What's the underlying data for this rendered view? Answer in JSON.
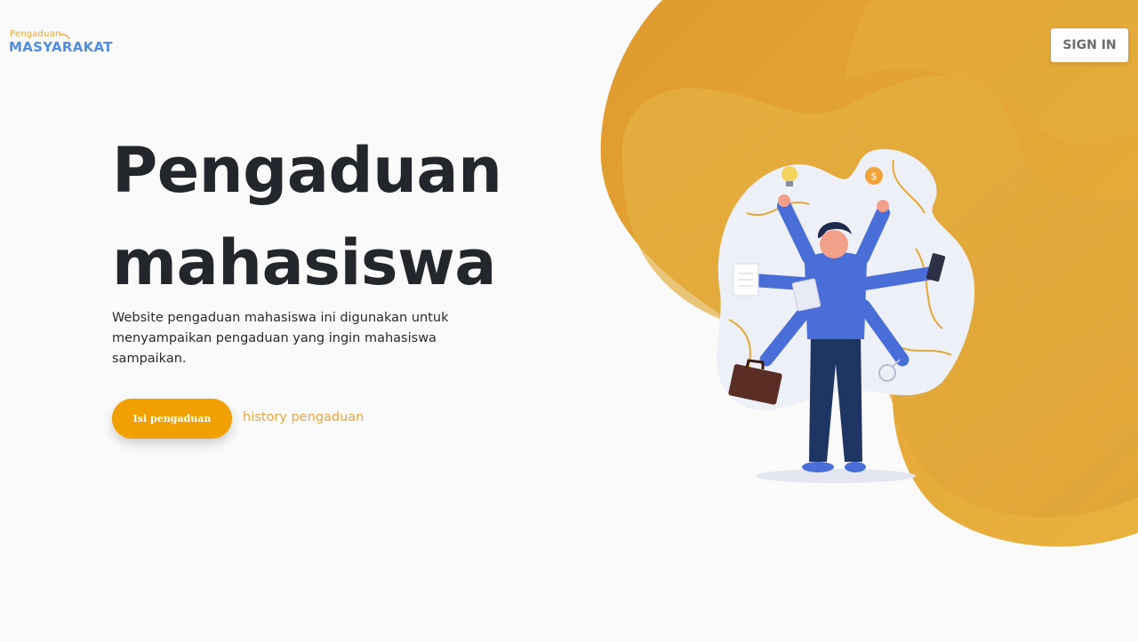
{
  "colors": {
    "accent": "#f0a000",
    "blob": "#e3a838",
    "title": "#23272b",
    "logo_blue": "#4f8ee0",
    "logo_orange": "#f0a43a"
  },
  "logo": {
    "small_text": "Pengaduan",
    "big_text": "MASYARAKAT"
  },
  "header": {
    "signin_label": "SIGN IN"
  },
  "hero": {
    "title_line1": "Pengaduan",
    "title_line2": "mahasiswa",
    "description": "Website pengaduan mahasiswa ini digunakan untuk menyampaikan pengaduan yang ingin mahasiswa sampaikan.",
    "primary_button": "Isi pengaduan",
    "secondary_link": "history pengaduan"
  },
  "illustration": {
    "icons": [
      "lightbulb-icon",
      "coin-icon",
      "phone-icon",
      "briefcase-icon",
      "document-icon",
      "tablet-icon",
      "magnifier-icon"
    ]
  }
}
